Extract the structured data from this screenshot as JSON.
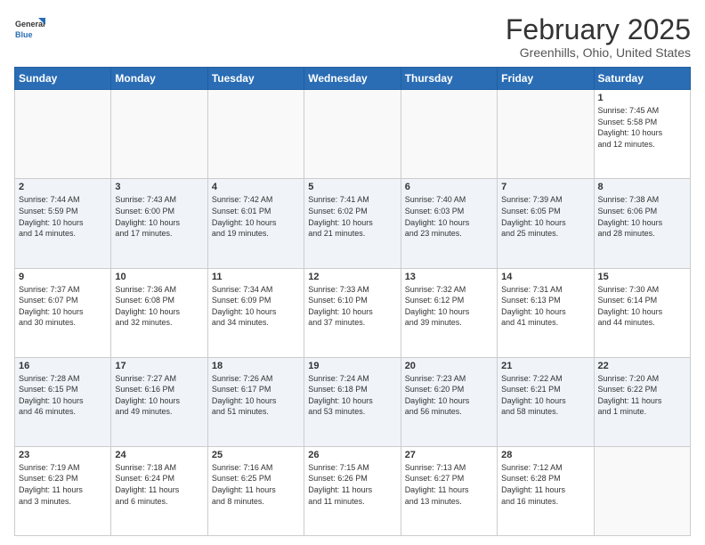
{
  "header": {
    "logo_general": "General",
    "logo_blue": "Blue",
    "main_title": "February 2025",
    "subtitle": "Greenhills, Ohio, United States"
  },
  "days_of_week": [
    "Sunday",
    "Monday",
    "Tuesday",
    "Wednesday",
    "Thursday",
    "Friday",
    "Saturday"
  ],
  "weeks": [
    {
      "shade": "white",
      "days": [
        {
          "num": "",
          "info": ""
        },
        {
          "num": "",
          "info": ""
        },
        {
          "num": "",
          "info": ""
        },
        {
          "num": "",
          "info": ""
        },
        {
          "num": "",
          "info": ""
        },
        {
          "num": "",
          "info": ""
        },
        {
          "num": "1",
          "info": "Sunrise: 7:45 AM\nSunset: 5:58 PM\nDaylight: 10 hours\nand 12 minutes."
        }
      ]
    },
    {
      "shade": "shaded",
      "days": [
        {
          "num": "2",
          "info": "Sunrise: 7:44 AM\nSunset: 5:59 PM\nDaylight: 10 hours\nand 14 minutes."
        },
        {
          "num": "3",
          "info": "Sunrise: 7:43 AM\nSunset: 6:00 PM\nDaylight: 10 hours\nand 17 minutes."
        },
        {
          "num": "4",
          "info": "Sunrise: 7:42 AM\nSunset: 6:01 PM\nDaylight: 10 hours\nand 19 minutes."
        },
        {
          "num": "5",
          "info": "Sunrise: 7:41 AM\nSunset: 6:02 PM\nDaylight: 10 hours\nand 21 minutes."
        },
        {
          "num": "6",
          "info": "Sunrise: 7:40 AM\nSunset: 6:03 PM\nDaylight: 10 hours\nand 23 minutes."
        },
        {
          "num": "7",
          "info": "Sunrise: 7:39 AM\nSunset: 6:05 PM\nDaylight: 10 hours\nand 25 minutes."
        },
        {
          "num": "8",
          "info": "Sunrise: 7:38 AM\nSunset: 6:06 PM\nDaylight: 10 hours\nand 28 minutes."
        }
      ]
    },
    {
      "shade": "white",
      "days": [
        {
          "num": "9",
          "info": "Sunrise: 7:37 AM\nSunset: 6:07 PM\nDaylight: 10 hours\nand 30 minutes."
        },
        {
          "num": "10",
          "info": "Sunrise: 7:36 AM\nSunset: 6:08 PM\nDaylight: 10 hours\nand 32 minutes."
        },
        {
          "num": "11",
          "info": "Sunrise: 7:34 AM\nSunset: 6:09 PM\nDaylight: 10 hours\nand 34 minutes."
        },
        {
          "num": "12",
          "info": "Sunrise: 7:33 AM\nSunset: 6:10 PM\nDaylight: 10 hours\nand 37 minutes."
        },
        {
          "num": "13",
          "info": "Sunrise: 7:32 AM\nSunset: 6:12 PM\nDaylight: 10 hours\nand 39 minutes."
        },
        {
          "num": "14",
          "info": "Sunrise: 7:31 AM\nSunset: 6:13 PM\nDaylight: 10 hours\nand 41 minutes."
        },
        {
          "num": "15",
          "info": "Sunrise: 7:30 AM\nSunset: 6:14 PM\nDaylight: 10 hours\nand 44 minutes."
        }
      ]
    },
    {
      "shade": "shaded",
      "days": [
        {
          "num": "16",
          "info": "Sunrise: 7:28 AM\nSunset: 6:15 PM\nDaylight: 10 hours\nand 46 minutes."
        },
        {
          "num": "17",
          "info": "Sunrise: 7:27 AM\nSunset: 6:16 PM\nDaylight: 10 hours\nand 49 minutes."
        },
        {
          "num": "18",
          "info": "Sunrise: 7:26 AM\nSunset: 6:17 PM\nDaylight: 10 hours\nand 51 minutes."
        },
        {
          "num": "19",
          "info": "Sunrise: 7:24 AM\nSunset: 6:18 PM\nDaylight: 10 hours\nand 53 minutes."
        },
        {
          "num": "20",
          "info": "Sunrise: 7:23 AM\nSunset: 6:20 PM\nDaylight: 10 hours\nand 56 minutes."
        },
        {
          "num": "21",
          "info": "Sunrise: 7:22 AM\nSunset: 6:21 PM\nDaylight: 10 hours\nand 58 minutes."
        },
        {
          "num": "22",
          "info": "Sunrise: 7:20 AM\nSunset: 6:22 PM\nDaylight: 11 hours\nand 1 minute."
        }
      ]
    },
    {
      "shade": "white",
      "days": [
        {
          "num": "23",
          "info": "Sunrise: 7:19 AM\nSunset: 6:23 PM\nDaylight: 11 hours\nand 3 minutes."
        },
        {
          "num": "24",
          "info": "Sunrise: 7:18 AM\nSunset: 6:24 PM\nDaylight: 11 hours\nand 6 minutes."
        },
        {
          "num": "25",
          "info": "Sunrise: 7:16 AM\nSunset: 6:25 PM\nDaylight: 11 hours\nand 8 minutes."
        },
        {
          "num": "26",
          "info": "Sunrise: 7:15 AM\nSunset: 6:26 PM\nDaylight: 11 hours\nand 11 minutes."
        },
        {
          "num": "27",
          "info": "Sunrise: 7:13 AM\nSunset: 6:27 PM\nDaylight: 11 hours\nand 13 minutes."
        },
        {
          "num": "28",
          "info": "Sunrise: 7:12 AM\nSunset: 6:28 PM\nDaylight: 11 hours\nand 16 minutes."
        },
        {
          "num": "",
          "info": ""
        }
      ]
    }
  ]
}
